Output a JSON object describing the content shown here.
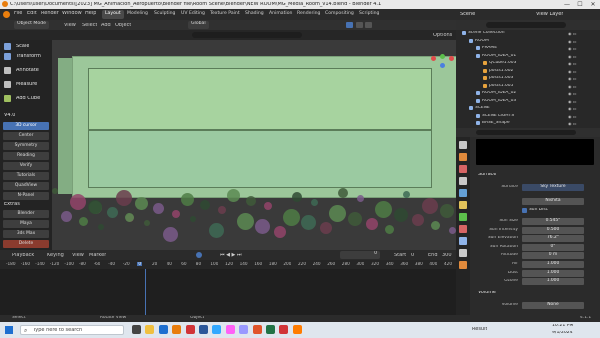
{
  "window": {
    "title": "C:\\Users\\user\\Documents\\[2023] MG_Animacion_Aeropuerto\\Blender file\\Room Scene\\Blender\\NEW ROOM\\MG_Media_Room_v14.blend - Blender 4.1",
    "minimize": "—",
    "maximize": "☐",
    "close": "✕"
  },
  "menubar": {
    "items": [
      "File",
      "Edit",
      "Render",
      "Window",
      "Help"
    ],
    "workspaces": [
      "Layout",
      "Modeling",
      "Sculpting",
      "UV Editing",
      "Texture Paint",
      "Shading",
      "Animation",
      "Rendering",
      "Compositing",
      "Scripting"
    ],
    "active_workspace": "Layout",
    "scene_label": "Scene",
    "view_layer_label": "View Layer"
  },
  "viewport_header": {
    "mode": "Object Mode",
    "menus": [
      "View",
      "Select",
      "Add",
      "Object"
    ],
    "transform_orientation": "Global",
    "options_label": "Options"
  },
  "toolbar": {
    "tools": [
      "Scale",
      "Transform",
      "Annotate",
      "Measure",
      "Add Cube"
    ],
    "section_title": "V4.0",
    "buttons": [
      "3D cursor",
      "Center",
      "Symmetry",
      "Reading",
      "Verify",
      "Tutorials",
      "QuadView",
      "N-Panel"
    ],
    "extras_title": "Extras",
    "extras": [
      "Blender",
      "Maya",
      "3ds Max",
      "Delete"
    ],
    "selected_button": "3D cursor"
  },
  "timeline": {
    "menus": [
      "Playback",
      "Keying",
      "View",
      "Marker"
    ],
    "current_frame": "0",
    "start_label": "Start",
    "start_value": "0",
    "end_label": "End",
    "end_value": "300",
    "ruler": [
      "-180",
      "-160",
      "-140",
      "-120",
      "-100",
      "-80",
      "-60",
      "-40",
      "-20",
      "0",
      "20",
      "40",
      "60",
      "80",
      "100",
      "120",
      "140",
      "160",
      "180",
      "200",
      "220",
      "240",
      "260",
      "280",
      "300",
      "320",
      "340",
      "360",
      "380",
      "400",
      "420"
    ]
  },
  "statusbar": {
    "items": [
      "Select",
      "Rotate View",
      "Object"
    ],
    "version": "4.1.1"
  },
  "taskbar": {
    "search_placeholder": "Type here to search",
    "weather": "Rain...",
    "time": "10:21 PM",
    "date": "9/1/2024",
    "result_label": "Result"
  },
  "outliner": {
    "title": "Scene Collection",
    "rows": [
      {
        "label": "Scene Collection",
        "indent": 0,
        "hl": false
      },
      {
        "label": "ROOM",
        "indent": 1,
        "hl": false
      },
      {
        "label": "FRAME",
        "indent": 2,
        "hl": false
      },
      {
        "label": "ROOM_IDEA_01",
        "indent": 2,
        "hl": false
      },
      {
        "label": "QCube1.003",
        "indent": 3,
        "hl": false
      },
      {
        "label": "posts1.002",
        "indent": 3,
        "hl": false
      },
      {
        "label": "posts1.003",
        "indent": 3,
        "hl": false
      },
      {
        "label": "posts1.005",
        "indent": 3,
        "hl": false
      },
      {
        "label": "ROOM_IDEA_02",
        "indent": 2,
        "hl": false
      },
      {
        "label": "ROOM_IDEA_03",
        "indent": 2,
        "hl": false
      },
      {
        "label": "SCENE",
        "indent": 1,
        "hl": false
      },
      {
        "label": "SCENE LIGHTS",
        "indent": 2,
        "hl": false
      },
      {
        "label": "BASE_Shape",
        "indent": 2,
        "hl": false
      }
    ]
  },
  "properties": {
    "surface_title": "Surface",
    "surface_label": "Surface",
    "surface_value": "Sky Texture",
    "sky_type": "Nishita",
    "sun_disc_label": "Sun Disc",
    "fields": [
      {
        "label": "Sun Size",
        "value": "0.545°"
      },
      {
        "label": "Sun Intensity",
        "value": "0.500"
      },
      {
        "label": "Sun Elevation",
        "value": "76.2°"
      },
      {
        "label": "Sun Rotation",
        "value": "0°"
      },
      {
        "label": "Altitude",
        "value": "0 m"
      },
      {
        "label": "Air",
        "value": "1.000"
      },
      {
        "label": "Dust",
        "value": "1.000"
      },
      {
        "label": "Ozone",
        "value": "1.000"
      }
    ],
    "volume_title": "Volume",
    "volume_label": "Volume",
    "volume_value": "None"
  },
  "colors": {
    "accent": "#4772b3",
    "wall": "#a7d39f"
  }
}
